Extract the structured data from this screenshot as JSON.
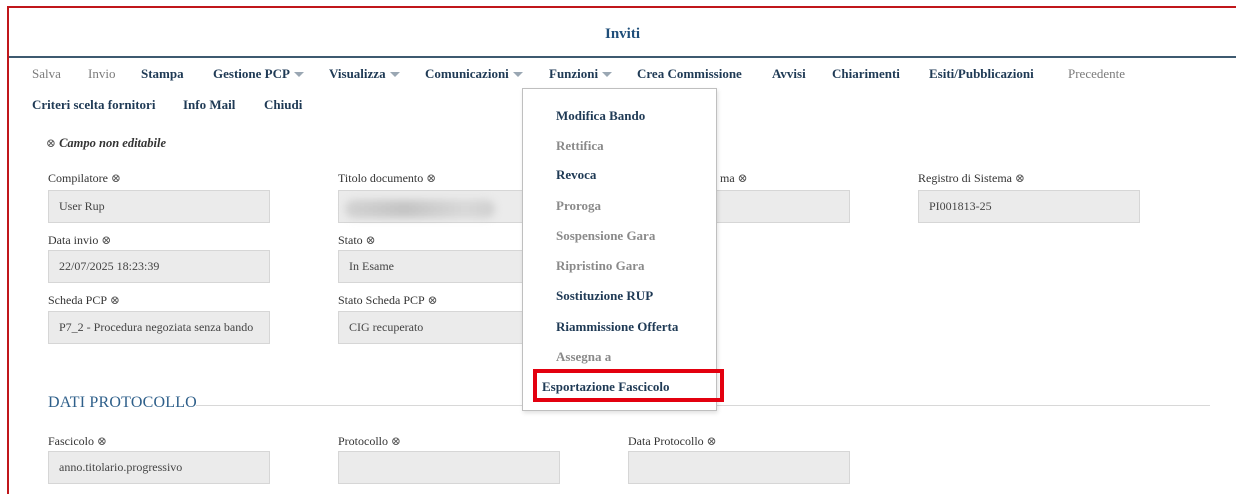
{
  "window": {
    "title": "Inviti"
  },
  "toolbar": {
    "row1": [
      {
        "label": "Salva",
        "enabled": false,
        "dropdown": false
      },
      {
        "label": "Invio",
        "enabled": false,
        "dropdown": false
      },
      {
        "label": "Stampa",
        "enabled": true,
        "dropdown": false
      },
      {
        "label": "Gestione PCP",
        "enabled": true,
        "dropdown": true
      },
      {
        "label": "Visualizza",
        "enabled": true,
        "dropdown": true
      },
      {
        "label": "Comunicazioni",
        "enabled": true,
        "dropdown": true
      },
      {
        "label": "Funzioni",
        "enabled": true,
        "dropdown": true
      },
      {
        "label": "Crea Commissione",
        "enabled": true,
        "dropdown": false
      },
      {
        "label": "Avvisi",
        "enabled": true,
        "dropdown": false
      },
      {
        "label": "Chiarimenti",
        "enabled": true,
        "dropdown": false
      },
      {
        "label": "Esiti/Pubblicazioni",
        "enabled": true,
        "dropdown": false
      },
      {
        "label": "Precedente",
        "enabled": false,
        "dropdown": false
      }
    ],
    "row2": [
      {
        "label": "Criteri scelta fornitori",
        "enabled": true
      },
      {
        "label": "Info Mail",
        "enabled": true
      },
      {
        "label": "Chiudi",
        "enabled": true
      }
    ]
  },
  "note": "Campo non editabile",
  "fields": {
    "compilatore": {
      "label": "Compilatore",
      "value": "User Rup"
    },
    "titolo_documento": {
      "label": "Titolo documento",
      "value": ""
    },
    "protocollo_sistema": {
      "label": "ma",
      "value": ""
    },
    "registro_sistema": {
      "label": "Registro di Sistema",
      "value": "PI001813-25"
    },
    "data_invio": {
      "label": "Data invio",
      "value": "22/07/2025 18:23:39"
    },
    "stato": {
      "label": "Stato",
      "value": "In Esame"
    },
    "scheda_pcp": {
      "label": "Scheda PCP",
      "value": "P7_2 - Procedura negoziata senza bando"
    },
    "stato_scheda_pcp": {
      "label": "Stato Scheda PCP",
      "value": "CIG recuperato"
    }
  },
  "section": {
    "title": "DATI PROTOCOLLO"
  },
  "protocollo_fields": {
    "fascicolo": {
      "label": "Fascicolo",
      "value": "anno.titolario.progressivo"
    },
    "protocollo": {
      "label": "Protocollo",
      "value": ""
    },
    "data_protocollo": {
      "label": "Data Protocollo",
      "value": ""
    }
  },
  "funzioni_menu": [
    {
      "label": "Modifica Bando",
      "enabled": true
    },
    {
      "label": "Rettifica",
      "enabled": false
    },
    {
      "label": "Revoca",
      "enabled": true
    },
    {
      "label": "Proroga",
      "enabled": false
    },
    {
      "label": "Sospensione Gara",
      "enabled": false
    },
    {
      "label": "Ripristino Gara",
      "enabled": false
    },
    {
      "label": "Sostituzione RUP",
      "enabled": true
    },
    {
      "label": "Riammissione Offerta",
      "enabled": true
    },
    {
      "label": "Assegna a",
      "enabled": false
    },
    {
      "label": "Esportazione Fascicolo",
      "enabled": true,
      "highlighted": true
    }
  ],
  "colors": {
    "frame_border": "#c0171b",
    "title": "#1f4e79",
    "link": "#1f3a55",
    "highlight": "#e3000f",
    "section": "#2e5f8a"
  }
}
